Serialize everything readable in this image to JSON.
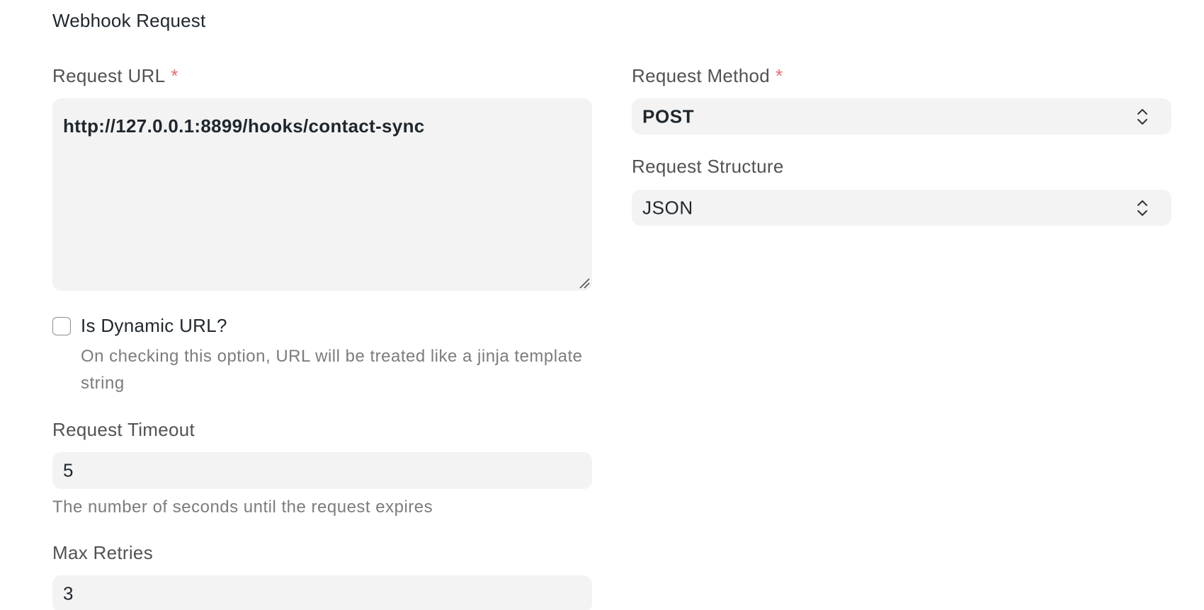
{
  "section": {
    "title": "Webhook Request"
  },
  "request_url": {
    "label": "Request URL",
    "required_mark": "*",
    "value": "http://127.0.0.1:8899/hooks/contact-sync"
  },
  "dynamic_url": {
    "label": "Is Dynamic URL?",
    "checked": false,
    "help": "On checking this option, URL will be treated like a jinja template string"
  },
  "request_timeout": {
    "label": "Request Timeout",
    "value": "5",
    "help": "The number of seconds until the request expires"
  },
  "max_retries": {
    "label": "Max Retries",
    "value": "3"
  },
  "request_method": {
    "label": "Request Method",
    "required_mark": "*",
    "selected": "POST"
  },
  "request_structure": {
    "label": "Request Structure",
    "selected": "JSON"
  },
  "icons": {
    "select_chevron": "chevron-up-down-icon",
    "resize": "resize-handle-icon"
  },
  "colors": {
    "field_bg": "#f3f3f3",
    "required": "#e86c6c",
    "label": "#525252",
    "help": "#7c7c7c"
  }
}
